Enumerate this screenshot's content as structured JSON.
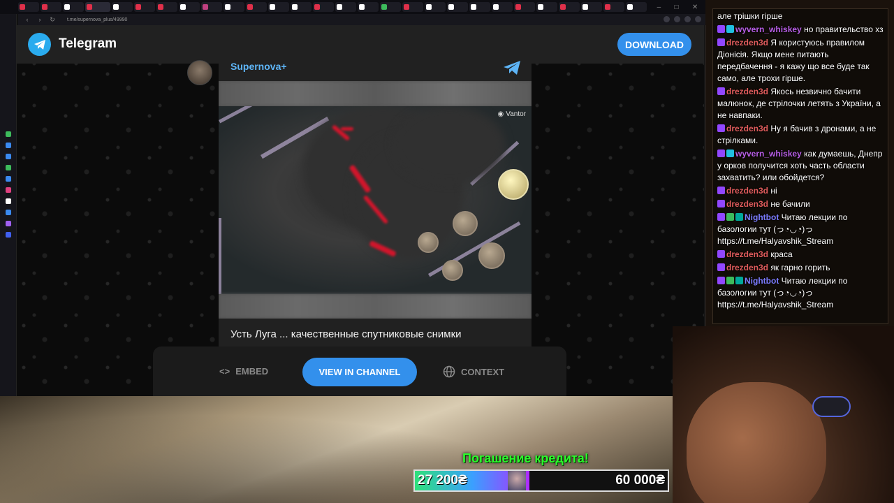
{
  "browser": {
    "url": "t.me/supernova_plus/49990",
    "controls": {
      "minimize": "–",
      "maximize": "□",
      "close": "✕"
    },
    "tab_colors": [
      "#e0304a",
      "#e0304a",
      "#ffffff",
      "#e0304a",
      "#ffffff",
      "#e0304a",
      "#e0304a",
      "#ffffff",
      "#c04080",
      "#ffffff",
      "#e0304a",
      "#ffffff",
      "#ffffff",
      "#e0304a",
      "#ffffff",
      "#ffffff",
      "#3dbb5c",
      "#e0304a",
      "#ffffff",
      "#ffffff",
      "#ffffff",
      "#ffffff",
      "#e0304a",
      "#ffffff",
      "#e0304a",
      "#ffffff",
      "#e0304a",
      "#ffffff"
    ],
    "sidebar_icons": [
      "#3dbb5c",
      "#3a8af0",
      "#3a8af0",
      "#3dbb5c",
      "#3a8af0",
      "#e04080",
      "#ffffff",
      "#3a8af0",
      "#a060f0",
      "#4060f0"
    ]
  },
  "telegram": {
    "brand": "Telegram",
    "download_label": "DOWNLOAD",
    "channel_name": "Supernova+",
    "watermark": "Vantor",
    "caption": "Усть Луга ... качественные спутниковые снимки",
    "embed_label": "EMBED",
    "view_label": "VIEW IN CHANNEL",
    "context_label": "CONTEXT",
    "accent": "#3390ec"
  },
  "chat": [
    {
      "user": "",
      "color": "#ffffff",
      "text": "але трішки гірше",
      "badges": []
    },
    {
      "user": "wyvern_whiskey",
      "color": "#b75ee6",
      "text": "но правительство хз",
      "badges": [
        "#9147ff",
        "#20c0e0"
      ]
    },
    {
      "user": "drezden3d",
      "color": "#e05c5c",
      "text": "Я користуюсь правилом Діонісія. Якщо мене питають передбачення - я кажу що все буде так само, але трохи гірше.",
      "badges": [
        "#9147ff"
      ]
    },
    {
      "user": "drezden3d",
      "color": "#e05c5c",
      "text": "Якось незвично бачити малюнок, де стрілочки летять з України, а не навпаки.",
      "badges": [
        "#9147ff"
      ]
    },
    {
      "user": "drezden3d",
      "color": "#e05c5c",
      "text": "Ну я бачив з дронами, а не стрілками.",
      "badges": [
        "#9147ff"
      ]
    },
    {
      "user": "wyvern_whiskey",
      "color": "#b75ee6",
      "text": "как думаешь, Днепр у орков получится хоть часть области захватить? или обойдется?",
      "badges": [
        "#9147ff",
        "#20c0e0"
      ]
    },
    {
      "user": "drezden3d",
      "color": "#e05c5c",
      "text": "ні",
      "badges": [
        "#9147ff"
      ]
    },
    {
      "user": "drezden3d",
      "color": "#e05c5c",
      "text": "не бачили",
      "badges": [
        "#9147ff"
      ]
    },
    {
      "user": "Nightbot",
      "color": "#7c7cff",
      "text": "Читаю лекции по базологии тут (っ◔◡◔)っ https://t.me/Halyavshik_Stream",
      "badges": [
        "#9147ff",
        "#3dbb5c",
        "#00a89a"
      ]
    },
    {
      "user": "drezden3d",
      "color": "#e05c5c",
      "text": "краса",
      "badges": [
        "#9147ff"
      ]
    },
    {
      "user": "drezden3d",
      "color": "#e05c5c",
      "text": "як гарно горить",
      "badges": [
        "#9147ff"
      ]
    },
    {
      "user": "Nightbot",
      "color": "#7c7cff",
      "text": "Читаю лекции по базологии тут (っ◔◡◔)っ https://t.me/Halyavshik_Stream",
      "badges": [
        "#9147ff",
        "#3dbb5c",
        "#00a89a"
      ]
    }
  ],
  "credit": {
    "title": "Погашение кредита!",
    "current": "27 200₴",
    "goal": "60 000₴",
    "progress": 0.4533
  }
}
